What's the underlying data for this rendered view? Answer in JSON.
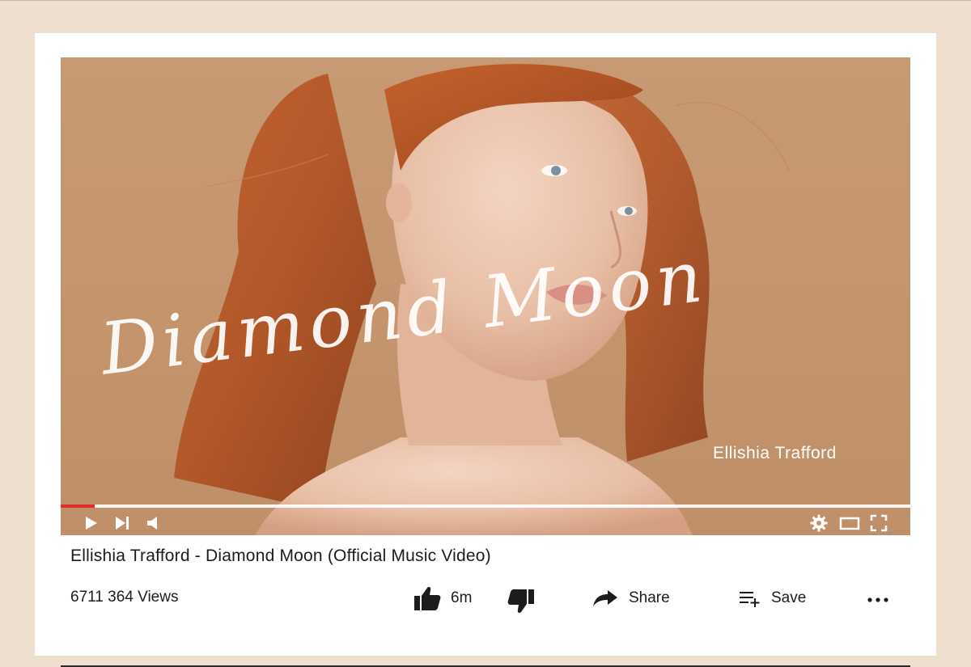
{
  "video": {
    "script_title": "Diamond Moon",
    "artist": "Ellishia Trafford",
    "progress": 0.04,
    "colors": {
      "progress": "#e52b2b",
      "track": "#ffffff",
      "background": "#c4946d"
    }
  },
  "controls": {
    "icons": [
      "play-icon",
      "skip-next-icon",
      "volume-icon",
      "settings-icon",
      "theater-mode-icon",
      "fullscreen-icon"
    ]
  },
  "info": {
    "title": "Ellishia Trafford - Diamond Moon (Official Music Video)",
    "views": "6711 364 Views",
    "like_count": "6m",
    "share_label": "Share",
    "save_label": "Save"
  }
}
